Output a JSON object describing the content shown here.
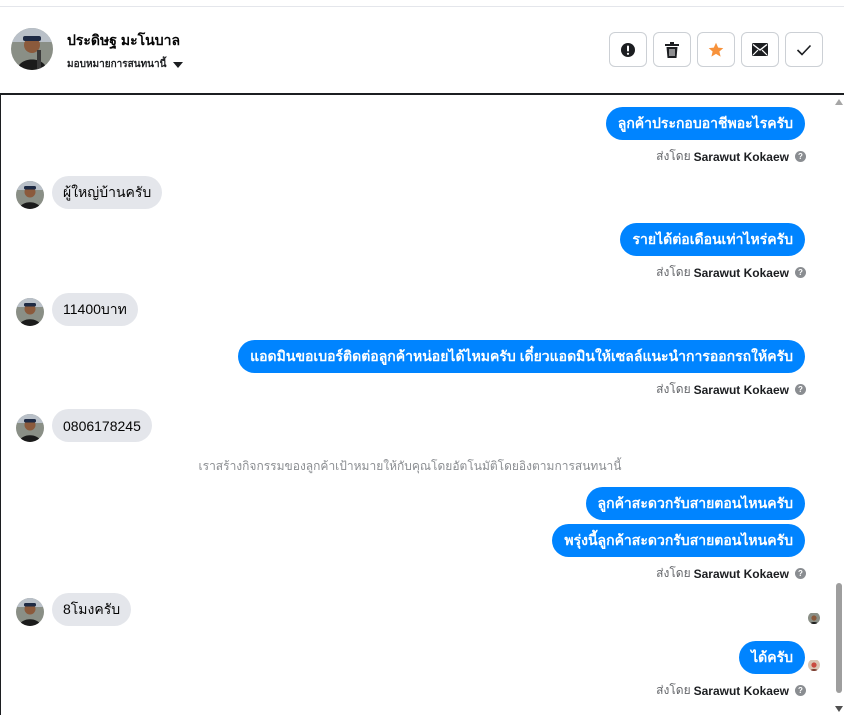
{
  "contact": {
    "name": "ประดิษฐ มะโนบาล",
    "assign_label": "มอบหมายการสนทนานี้"
  },
  "actions": [
    {
      "icon": "alert-icon"
    },
    {
      "icon": "trash-icon"
    },
    {
      "icon": "star-icon",
      "color": "#f7923b"
    },
    {
      "icon": "mail-icon"
    },
    {
      "icon": "check-icon"
    }
  ],
  "sent_by": {
    "prefix": "ส่งโดย",
    "agent": "Sarawut Kokaew"
  },
  "messages": [
    {
      "dir": "out",
      "text": "ลูกค้าประกอบอาชีพอะไรครับ"
    },
    {
      "dir": "in",
      "text": "ผู้ใหญ่บ้านครับ"
    },
    {
      "dir": "out",
      "text": "รายได้ต่อเดือนเท่าไหร่ครับ"
    },
    {
      "dir": "in",
      "text": "11400บาท"
    },
    {
      "dir": "out",
      "text": "แอดมินขอเบอร์ติดต่อลูกค้าหน่อยได้ไหมครับ เดี๋ยวแอดมินให้เซลล์แนะนำการออกรถให้ครับ"
    },
    {
      "dir": "in",
      "text": "0806178245"
    },
    {
      "dir": "system",
      "text": "เราสร้างกิจกรรมของลูกค้าเป้าหมายให้กับคุณโดยอัตโนมัติโดยอิงตามการสนทนานี้"
    },
    {
      "dir": "out",
      "text": "ลูกค้าสะดวกรับสายตอนไหนครับ"
    },
    {
      "dir": "out",
      "text": "พรุ่งนี้ลูกค้าสะดวกรับสายตอนไหนครับ"
    },
    {
      "dir": "in",
      "text": "8โมงครับ"
    },
    {
      "dir": "out",
      "text": "ได้ครับ"
    }
  ],
  "colors": {
    "outgoing_bubble": "#0084ff",
    "incoming_bubble": "#e4e6eb"
  }
}
